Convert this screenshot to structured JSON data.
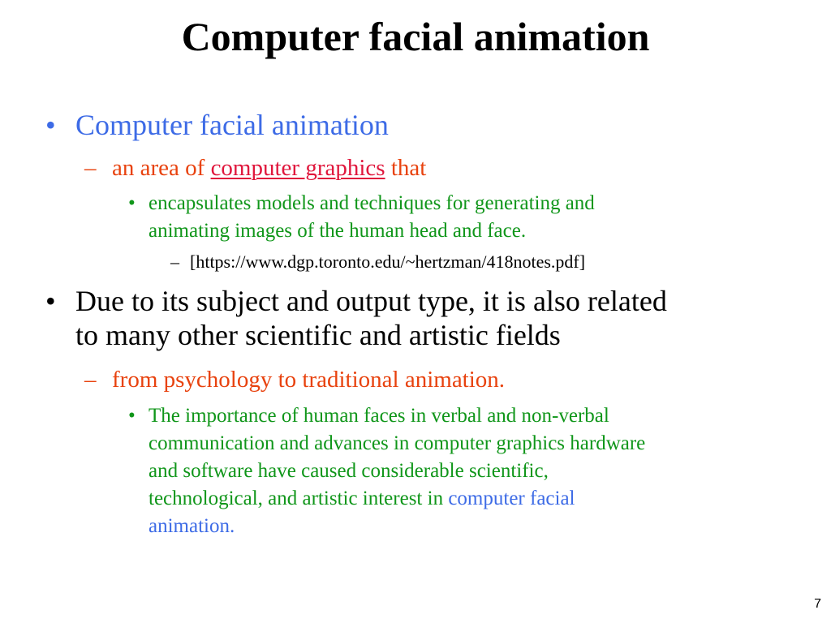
{
  "slide": {
    "title": "Computer facial animation",
    "page_number": "7",
    "bullets": [
      {
        "marker": "•",
        "text": "Computer facial animation"
      },
      {
        "marker": "–",
        "pre": "an area of ",
        "link": "computer graphics",
        "post": " that"
      },
      {
        "marker": "•",
        "lines": [
          "encapsulates models and techniques for generating and",
          "animating images of the human head and face."
        ]
      },
      {
        "marker": "–",
        "text": "[https://www.dgp.toronto.edu/~hertzman/418notes.pdf]"
      },
      {
        "marker": "•",
        "lines": [
          "Due to its subject and output type, it is also related",
          "to many other scientific and artistic fields"
        ]
      },
      {
        "marker": "–",
        "text": "from psychology to traditional animation."
      },
      {
        "marker": "•",
        "lines": [
          "The importance of human faces in verbal and non-verbal",
          "communication and advances in computer graphics hardware",
          "and software have caused considerable scientific,",
          "technological, and artistic interest in "
        ],
        "highlight_1": "computer facial",
        "highlight_2": "animation",
        "end": "."
      }
    ]
  },
  "colors": {
    "level1": "#3d6be6",
    "level2": "#e8420e",
    "link": "#e0163c",
    "level3": "#10961a"
  }
}
